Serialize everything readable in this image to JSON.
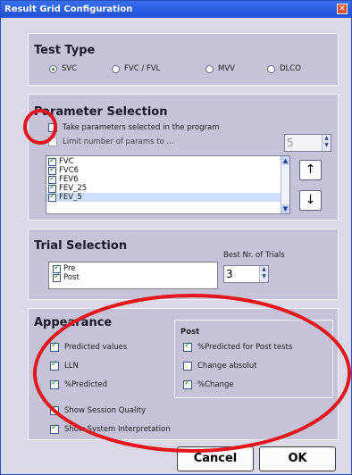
{
  "title": "Result Grid Configuration",
  "test_type": {
    "heading": "Test Type",
    "options": [
      {
        "label": "SVC",
        "selected": true
      },
      {
        "label": "FVC / FVL",
        "selected": false
      },
      {
        "label": "MVV",
        "selected": false
      },
      {
        "label": "DLCO",
        "selected": false
      }
    ]
  },
  "parameter_selection": {
    "heading": "Parameter Selection",
    "take_params_label": "Take parameters selected in the program",
    "take_params_checked": false,
    "limit_label": "Limit number of params to ...",
    "limit_value": "5",
    "params": [
      {
        "label": "FVC",
        "checked": true
      },
      {
        "label": "FVC6",
        "checked": true
      },
      {
        "label": "FEV6",
        "checked": true
      },
      {
        "label": "FEV_25",
        "checked": true
      },
      {
        "label": "FEV_5",
        "checked": true
      }
    ],
    "move_up_symbol": "↑",
    "move_down_symbol": "↓"
  },
  "trial_selection": {
    "heading": "Trial Selection",
    "trials": [
      {
        "label": "Pre",
        "checked": true
      },
      {
        "label": "Post",
        "checked": true
      }
    ],
    "best_label": "Best Nr. of Trials",
    "best_value": "3"
  },
  "appearance": {
    "heading": "Appearance",
    "left_options": [
      {
        "label": "Predicted values",
        "checked": true
      },
      {
        "label": "LLN",
        "checked": true
      },
      {
        "label": "%Predicted",
        "checked": true
      }
    ],
    "post_heading": "Post",
    "post_options": [
      {
        "label": "%Predicted for Post tests",
        "checked": true
      },
      {
        "label": "Change absolut",
        "checked": false
      },
      {
        "label": "%Change",
        "checked": true
      }
    ],
    "show_session_quality": {
      "label": "Show Session Quality",
      "checked": true
    },
    "show_system_interpretation": {
      "label": "Show System Interpretation",
      "checked": true
    }
  },
  "buttons": {
    "cancel": "Cancel",
    "ok": "OK"
  },
  "colors": {
    "annotation_red": "#e8141c",
    "title_bar": "#2a5be6",
    "check_green": "#1c8a1c"
  }
}
